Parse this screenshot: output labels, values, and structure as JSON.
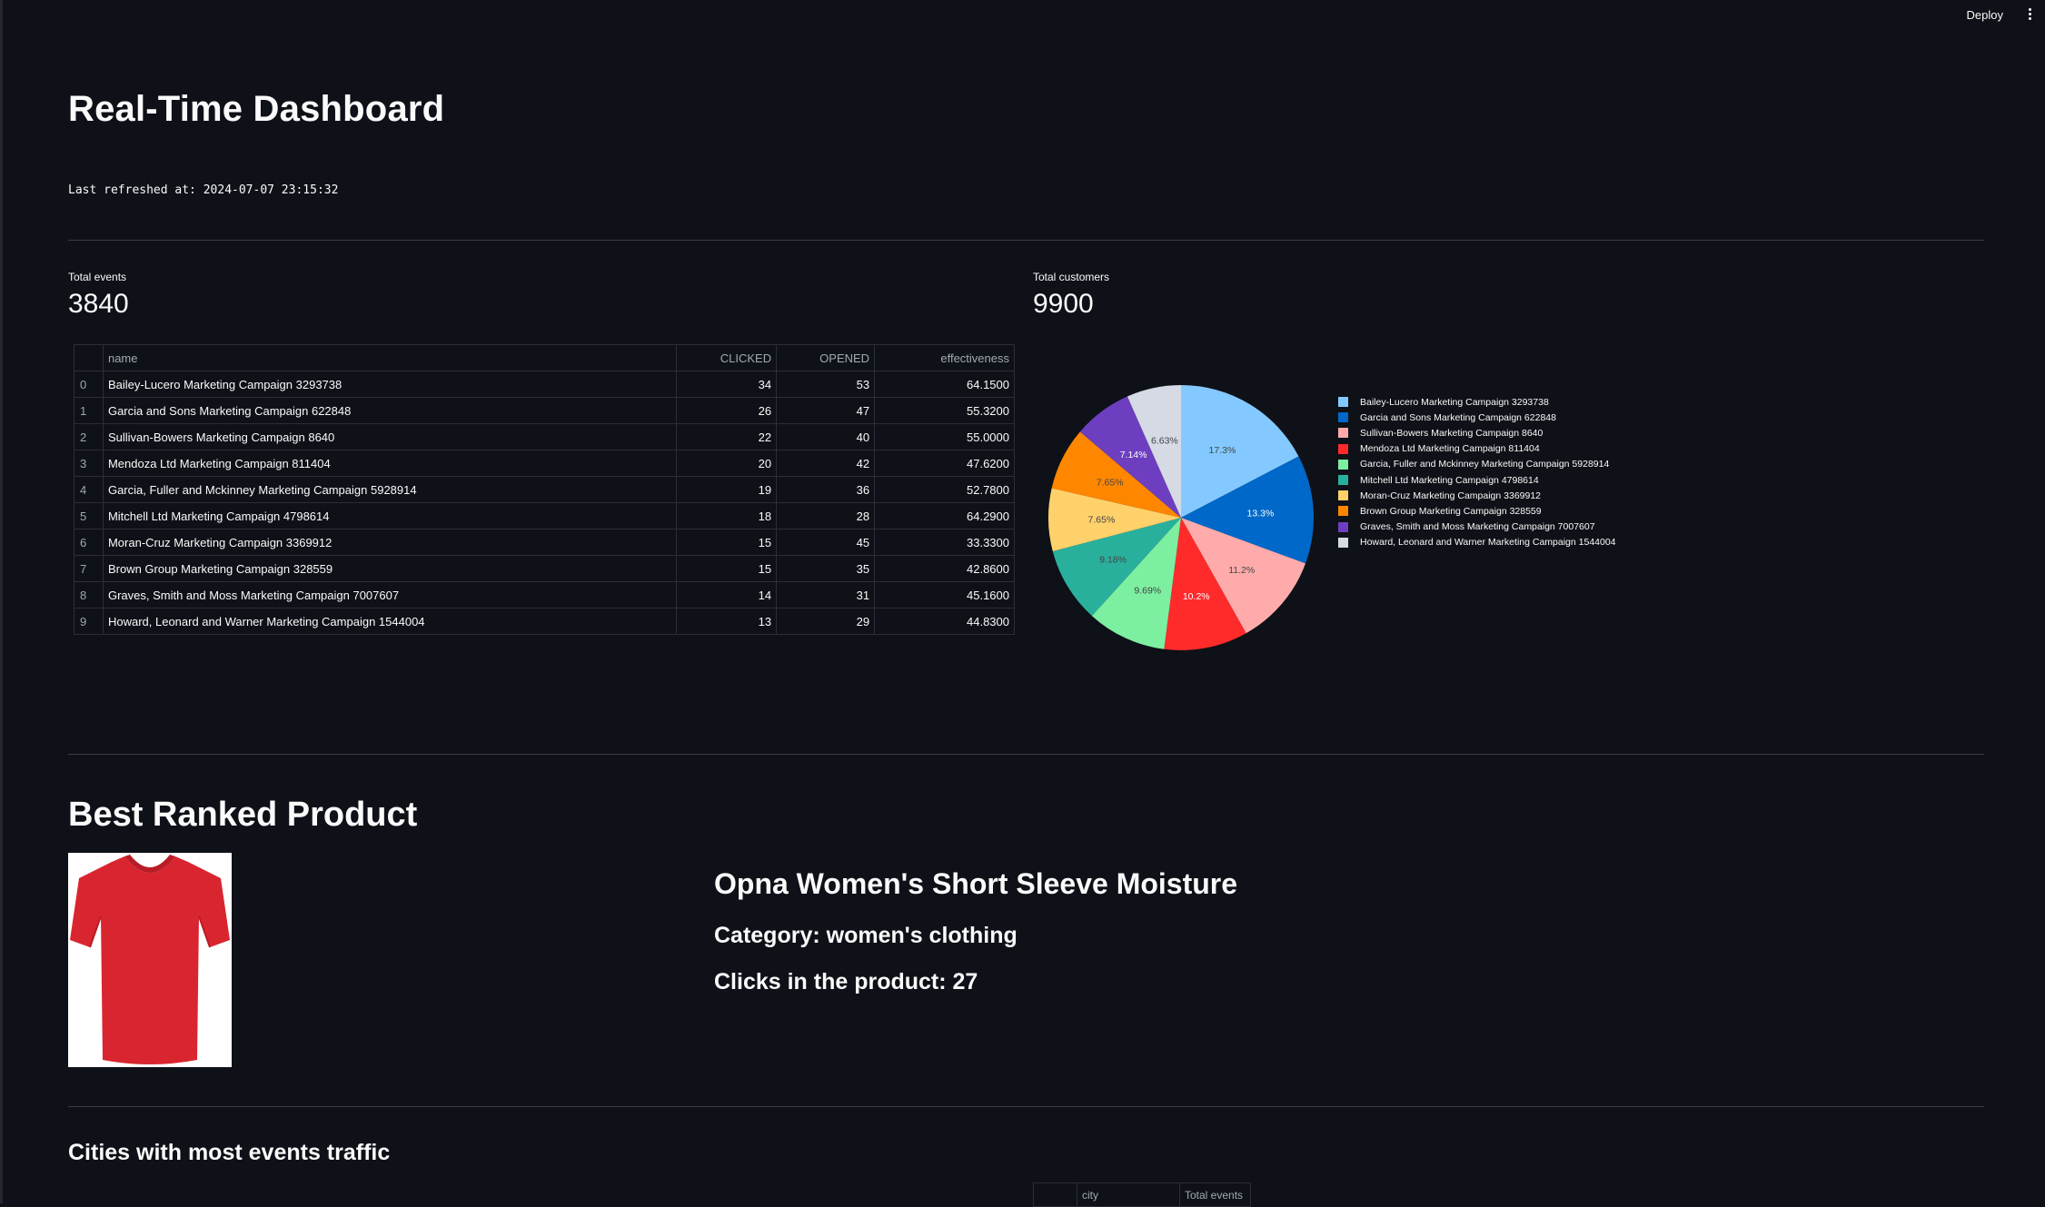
{
  "toolbar": {
    "deploy_label": "Deploy",
    "menu_icon": "vertical-dots-icon"
  },
  "header": {
    "title": "Real-Time Dashboard",
    "refresh_label": "Last refreshed at:",
    "refresh_time": "2024-07-07 23:15:32"
  },
  "metrics": {
    "events": {
      "label": "Total events",
      "value": "3840"
    },
    "customers": {
      "label": "Total customers",
      "value": "9900"
    }
  },
  "campaign_table": {
    "headers": [
      "",
      "name",
      "CLICKED",
      "OPENED",
      "effectiveness"
    ],
    "rows": [
      [
        "0",
        "Bailey-Lucero Marketing Campaign 3293738",
        "34",
        "53",
        "64.1500"
      ],
      [
        "1",
        "Garcia and Sons Marketing Campaign 622848",
        "26",
        "47",
        "55.3200"
      ],
      [
        "2",
        "Sullivan-Bowers Marketing Campaign 8640",
        "22",
        "40",
        "55.0000"
      ],
      [
        "3",
        "Mendoza Ltd Marketing Campaign 811404",
        "20",
        "42",
        "47.6200"
      ],
      [
        "4",
        "Garcia, Fuller and Mckinney Marketing Campaign 5928914",
        "19",
        "36",
        "52.7800"
      ],
      [
        "5",
        "Mitchell Ltd Marketing Campaign 4798614",
        "18",
        "28",
        "64.2900"
      ],
      [
        "6",
        "Moran-Cruz Marketing Campaign 3369912",
        "15",
        "45",
        "33.3300"
      ],
      [
        "7",
        "Brown Group Marketing Campaign 328559",
        "15",
        "35",
        "42.8600"
      ],
      [
        "8",
        "Graves, Smith and Moss Marketing Campaign 7007607",
        "14",
        "31",
        "45.1600"
      ],
      [
        "9",
        "Howard, Leonard and Warner Marketing Campaign 1544004",
        "13",
        "29",
        "44.8300"
      ]
    ]
  },
  "chart_data": {
    "type": "pie",
    "categories": [
      "Bailey-Lucero Marketing Campaign 3293738",
      "Garcia and Sons Marketing Campaign 622848",
      "Sullivan-Bowers Marketing Campaign 8640",
      "Mendoza Ltd Marketing Campaign 811404",
      "Garcia, Fuller and Mckinney Marketing Campaign 5928914",
      "Mitchell Ltd Marketing Campaign 4798614",
      "Moran-Cruz Marketing Campaign 3369912",
      "Brown Group Marketing Campaign 328559",
      "Graves, Smith and Moss Marketing Campaign 7007607",
      "Howard, Leonard and Warner Marketing Campaign 1544004"
    ],
    "values": [
      34,
      26,
      22,
      20,
      19,
      18,
      15,
      15,
      14,
      13
    ],
    "percent_labels": [
      "17.3%",
      "13.3%",
      "11.2%",
      "10.2%",
      "9.69%",
      "9.18%",
      "7.65%",
      "7.65%",
      "7.14%",
      "6.63%"
    ],
    "colors": [
      "#83c9ff",
      "#0068c9",
      "#ffabab",
      "#ff2b2b",
      "#7defa1",
      "#29b09d",
      "#ffd16a",
      "#ff8700",
      "#6d3fc0",
      "#d5dae5"
    ],
    "direction": "clockwise",
    "start_angle_deg": 90,
    "legend_position": "right"
  },
  "product": {
    "section_title": "Best Ranked Product",
    "name": "Opna Women's Short Sleeve Moisture",
    "category": "Category: women's clothing",
    "clicks": "Clicks in the product: 27",
    "image_color": "#d9252f"
  },
  "cities": {
    "title": "Cities with most events traffic",
    "headers": [
      "",
      "city",
      "Total events"
    ]
  }
}
